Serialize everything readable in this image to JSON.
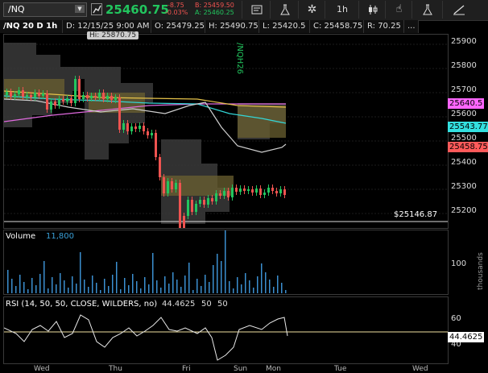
{
  "toolbar": {
    "symbol": "/NQ",
    "last_price": "25460.75",
    "net_change": "-8.75",
    "pct_change": "-0.03%",
    "bid": "B: 25459.50",
    "ask": "A: 25460.25",
    "timeframe": "1h",
    "icons": [
      "dropdown-arrow-icon",
      "stock-trend-icon",
      "news-icon",
      "flask-icon",
      "gear-icon",
      "candlestick-icon",
      "hand-cursor-icon",
      "flask-icon",
      "drawing-tools-icon"
    ]
  },
  "header": {
    "title": "/NQ 20 D 1h",
    "date": "D: 12/15/25 9:00 AM",
    "open": "O: 25479.25",
    "high": "H: 25490.75",
    "low": "L: 25420.5",
    "close": "C: 25458.75",
    "range": "R: 70.25",
    "more": "..."
  },
  "price_panel": {
    "hi_label": "Hi: 25870.75",
    "symbol_vertical": "/NQH26",
    "y_ticks": [
      "25900",
      "25800",
      "25700",
      "25600",
      "25500",
      "25400",
      "25300",
      "25200"
    ],
    "tags": [
      {
        "text": "25640.5",
        "color": "#ff66ff"
      },
      {
        "text": "25543.77",
        "color": "#33e0e0"
      },
      {
        "text": "25458.75",
        "color": "#ff5a5a"
      }
    ],
    "low_line_label": "$25146.87"
  },
  "volume_panel": {
    "title": "Volume",
    "value": "11,800",
    "tick": "100",
    "unit_vertical": "thousands"
  },
  "rsi_panel": {
    "title": "RSI (14, 50, 50, CLOSE, WILDERS, no)",
    "value": "44.4625",
    "param1": "50",
    "param2": "50",
    "ticks": [
      "60",
      "40"
    ],
    "tag": "44.4625"
  },
  "time_axis": [
    "Wed",
    "Thu",
    "Fri",
    "Sun",
    "Mon",
    "Tue",
    "Wed"
  ],
  "colors": {
    "up": "#22c55e",
    "down": "#ef5350",
    "accent": "#f0c040"
  }
}
